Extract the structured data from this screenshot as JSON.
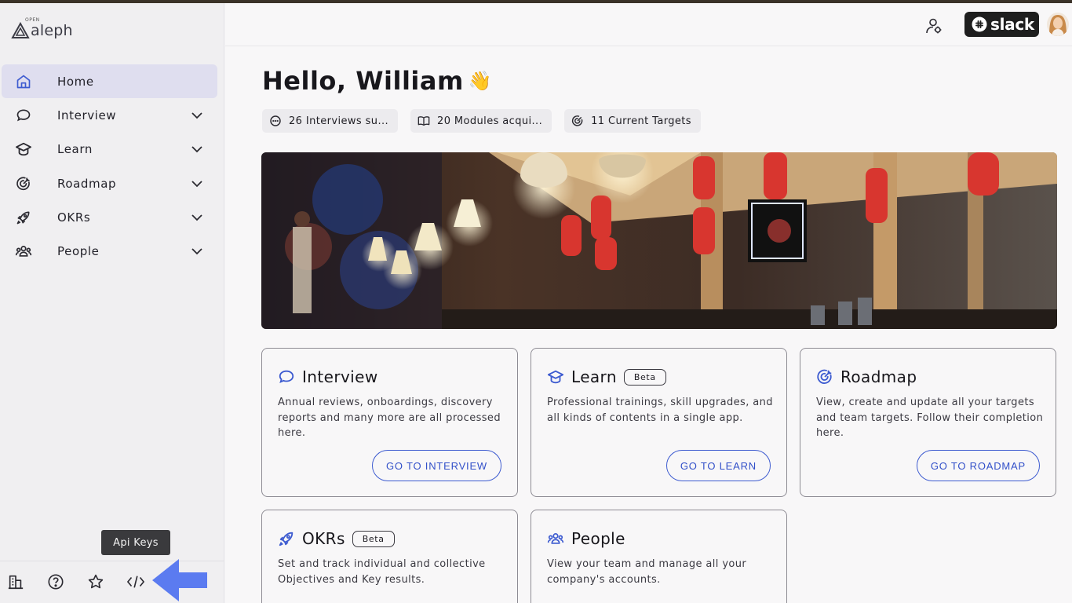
{
  "app": {
    "logo_small": "OPEN",
    "logo_name": "aleph"
  },
  "sidebar": {
    "items": [
      {
        "label": "Home",
        "icon": "home-icon",
        "active": true
      },
      {
        "label": "Interview",
        "icon": "chat-bubble-icon"
      },
      {
        "label": "Learn",
        "icon": "graduation-cap-icon"
      },
      {
        "label": "Roadmap",
        "icon": "target-icon"
      },
      {
        "label": "OKRs",
        "icon": "rocket-icon"
      },
      {
        "label": "People",
        "icon": "people-icon"
      }
    ],
    "bottom_icons": [
      "building-icon",
      "help-icon",
      "star-icon",
      "code-icon"
    ],
    "tooltip": "Api Keys"
  },
  "header": {
    "slack_label": "slack"
  },
  "main": {
    "greeting": "Hello, William",
    "wave": "👋",
    "stats": [
      {
        "label": "26 Interviews su...",
        "icon": "chat-bubble-icon"
      },
      {
        "label": "20 Modules acqui...",
        "icon": "book-icon"
      },
      {
        "label": "11 Current Targets",
        "icon": "target-icon"
      }
    ],
    "cards": [
      {
        "title": "Interview",
        "badge": "",
        "desc": "Annual reviews, onboardings, discovery reports and many more are all processed here.",
        "button": "GO TO INTERVIEW"
      },
      {
        "title": "Learn",
        "badge": "Beta",
        "desc": "Professional trainings, skill upgrades, and all kinds of contents in a single app.",
        "button": "GO TO LEARN"
      },
      {
        "title": "Roadmap",
        "badge": "",
        "desc": "View, create and update all your targets and team targets. Follow their completion here.",
        "button": "GO TO ROADMAP"
      },
      {
        "title": "OKRs",
        "badge": "Beta",
        "desc": "Set and track individual and collective Objectives and Key results.",
        "button": ""
      },
      {
        "title": "People",
        "badge": "",
        "desc": "View your team and manage all your company's accounts.",
        "button": ""
      }
    ]
  },
  "colors": {
    "accent": "#3d5bd0",
    "arrow": "#5b7bf0",
    "active_nav": "#dfdeef"
  }
}
